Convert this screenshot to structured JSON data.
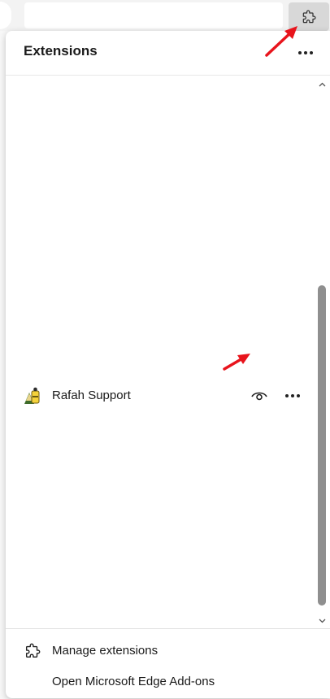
{
  "popup": {
    "title": "Extensions",
    "more_icon": "more-horizontal-icon"
  },
  "extensions": [
    {
      "name": "Rafah Support",
      "icon": "rafah-support-icon",
      "visibility_icon": "eye-icon",
      "more_icon": "more-horizontal-icon"
    }
  ],
  "footer": {
    "manage_label": "Manage extensions",
    "addons_label": "Open Microsoft Edge Add-ons",
    "manage_icon": "puzzle-icon"
  },
  "colors": {
    "annotation_arrow": "#e8141c",
    "scroll_thumb": "#8f8f8f",
    "ext_button_bg": "#d8d8d8"
  }
}
